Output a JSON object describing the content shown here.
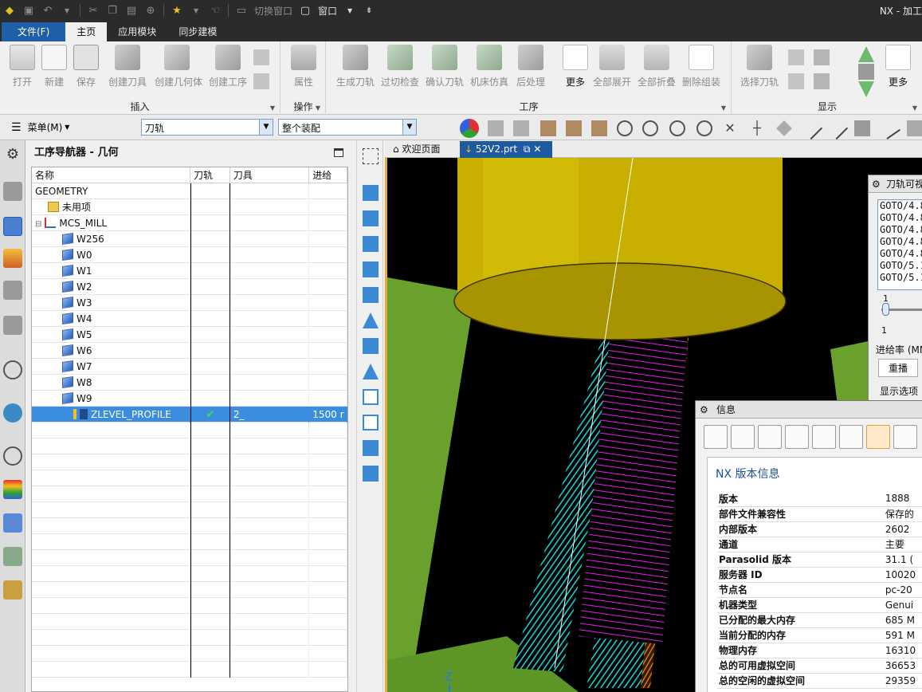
{
  "window": {
    "title": "NX - 加工"
  },
  "quick_access": {
    "switch_window": "切换窗口",
    "window_menu": "窗口"
  },
  "ribbon_tabs": [
    {
      "label": "文件(F)"
    },
    {
      "label": "主页"
    },
    {
      "label": "应用模块"
    },
    {
      "label": "同步建模"
    }
  ],
  "ribbon": {
    "groups": {
      "insert": "插入",
      "operate": "操作",
      "operation": "工序",
      "display": "显示"
    },
    "buttons": {
      "open": "打开",
      "new": "新建",
      "save": "保存",
      "create_tool": "创建刀具",
      "create_geometry": "创建几何体",
      "create_operation": "创建工序",
      "properties": "属性",
      "generate_toolpath": "生成刀轨",
      "gouge_check": "过切检查",
      "verify_toolpath": "确认刀轨",
      "machine_sim": "机床仿真",
      "postprocess": "后处理",
      "more1": "更多",
      "expand_all": "全部展开",
      "collapse_all": "全部折叠",
      "delete_group": "删除组装",
      "select_toolpath": "选择刀轨",
      "more2": "更多"
    }
  },
  "toolbar2": {
    "menu_label": "菜单(M)",
    "filter_value": "刀轨",
    "scope_value": "整个装配"
  },
  "navigator": {
    "title": "工序导航器 - 几何",
    "columns": [
      "名称",
      "刀轨",
      "刀具",
      "进给"
    ],
    "rows": [
      {
        "name": "GEOMETRY",
        "path": "",
        "tool": "",
        "feed": ""
      },
      {
        "name": "未用项",
        "path": "",
        "tool": "",
        "feed": ""
      },
      {
        "name": "MCS_MILL",
        "path": "",
        "tool": "",
        "feed": ""
      },
      {
        "name": "W256",
        "path": "",
        "tool": "",
        "feed": ""
      },
      {
        "name": "W0",
        "path": "",
        "tool": "",
        "feed": ""
      },
      {
        "name": "W1",
        "path": "",
        "tool": "",
        "feed": ""
      },
      {
        "name": "W2",
        "path": "",
        "tool": "",
        "feed": ""
      },
      {
        "name": "W3",
        "path": "",
        "tool": "",
        "feed": ""
      },
      {
        "name": "W4",
        "path": "",
        "tool": "",
        "feed": ""
      },
      {
        "name": "W5",
        "path": "",
        "tool": "",
        "feed": ""
      },
      {
        "name": "W6",
        "path": "",
        "tool": "",
        "feed": ""
      },
      {
        "name": "W7",
        "path": "",
        "tool": "",
        "feed": ""
      },
      {
        "name": "W8",
        "path": "",
        "tool": "",
        "feed": ""
      },
      {
        "name": "W9",
        "path": "",
        "tool": "",
        "feed": ""
      },
      {
        "name": "ZLEVEL_PROFILE",
        "path": "✔",
        "tool": "2_",
        "feed": "1500 r"
      }
    ]
  },
  "graphics_tabs": {
    "welcome": "欢迎页面",
    "part": "52V2.prt"
  },
  "toolpath_dialog": {
    "title": "刀轨可视",
    "lines": [
      "GOTO/4.8",
      "GOTO/4.8",
      "GOTO/4.8",
      "GOTO/4.8",
      "GOTO/4.8",
      "GOTO/5.1",
      "GOTO/5.1"
    ],
    "slider_min": "1",
    "slider_max": "1",
    "feed_label": "进给率 (MM",
    "replay_tab": "重播",
    "display_options": "显示选项"
  },
  "info_window": {
    "title": "信息",
    "heading": "NX 版本信息",
    "rows": [
      {
        "k": "版本",
        "v": "1888"
      },
      {
        "k": "部件文件兼容性",
        "v": "保存的"
      },
      {
        "k": "内部版本",
        "v": "2602"
      },
      {
        "k": "通道",
        "v": "主要"
      },
      {
        "k": "Parasolid 版本",
        "v": "31.1 ("
      },
      {
        "k": "服务器 ID",
        "v": "10020"
      },
      {
        "k": "节点名",
        "v": "pc-20"
      },
      {
        "k": "机器类型",
        "v": "Genui"
      },
      {
        "k": "已分配的最大内存",
        "v": "685 M"
      },
      {
        "k": "当前分配的内存",
        "v": "591 M"
      },
      {
        "k": "物理内存",
        "v": "16310"
      },
      {
        "k": "总的可用虚拟空间",
        "v": "36653"
      },
      {
        "k": "总的空闲的虚拟空间",
        "v": "29359"
      }
    ]
  },
  "colors": {
    "dark_bar": "#2b2b2b",
    "file_tab": "#1f5fa8",
    "selection": "#3b8de0",
    "tool_yellow": "#c9b000",
    "part_green": "#6aa02c",
    "path_cyan": "#18d6d6",
    "path_magenta": "#e020e0"
  }
}
